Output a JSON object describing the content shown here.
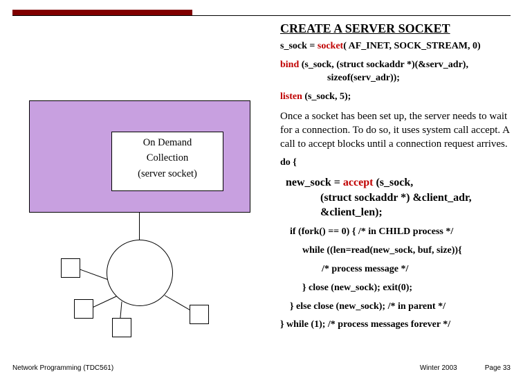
{
  "title": "CREATE A SERVER SOCKET",
  "code": {
    "socket_pre": "s_sock = ",
    "socket_kw": "socket",
    "socket_args": "( AF_INET, SOCK_STREAM, 0)",
    "bind_kw": "bind",
    "bind_l1": " (s_sock, (struct sockaddr *)(&serv_adr),",
    "bind_l2": "sizeof(serv_adr));",
    "listen_kw": "listen",
    "listen_args": " (s_sock, 5);",
    "paragraph": "Once a socket has been set up, the server needs to wait for a connection.  To do so, it uses system call accept.  A call to accept blocks until a connection request arrives.",
    "do_open": "do {",
    "accept_pre": "new_sock = ",
    "accept_kw": "accept",
    "accept_l1": " (s_sock,",
    "accept_l2": "(struct sockaddr *) &client_adr,",
    "accept_l3": "&client_len);",
    "fork_line": "if (fork() == 0) { /* in CHILD process */",
    "while_read": "while ((len=read(new_sock, buf, size)){",
    "process_msg": "/* process message */",
    "close_child": "} close (new_sock);  exit(0);",
    "else_parent": "} else close (new_sock); /* in parent */",
    "while_forever": "} while (1);  /* process messages forever */"
  },
  "diagram": {
    "inner_l1": "On Demand",
    "inner_l2": "Collection",
    "inner_l3": "(server socket)"
  },
  "footer": {
    "left": "Network Programming (TDC561)",
    "mid": "Winter 2003",
    "right": "Page 33"
  }
}
